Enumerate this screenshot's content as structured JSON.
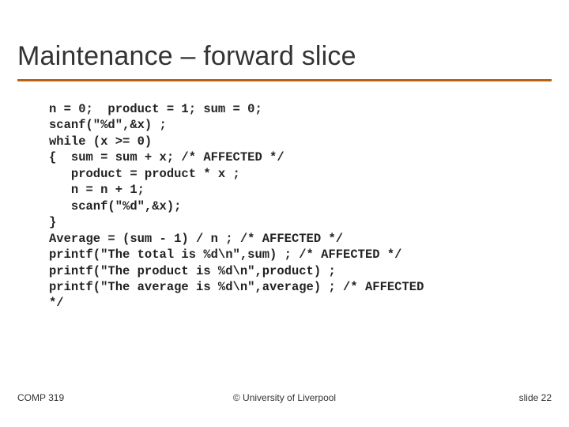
{
  "title": "Maintenance – forward slice",
  "code": "n = 0;  product = 1; sum = 0;\nscanf(\"%d\",&x) ;\nwhile (x >= 0)\n{  sum = sum + x; /* AFFECTED */\n   product = product * x ;\n   n = n + 1;\n   scanf(\"%d\",&x);\n}\nAverage = (sum - 1) / n ; /* AFFECTED */\nprintf(\"The total is %d\\n\",sum) ; /* AFFECTED */\nprintf(\"The product is %d\\n\",product) ;\nprintf(\"The average is %d\\n\",average) ; /* AFFECTED\n*/",
  "footer": {
    "left": "COMP 319",
    "center": "© University of Liverpool",
    "right": "slide  22"
  }
}
